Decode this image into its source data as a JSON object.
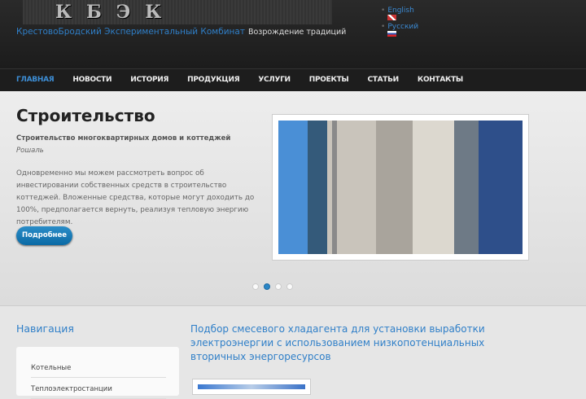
{
  "header": {
    "logo_text": "КБЭК",
    "site_name": "КрестовоБродский Экспериментальный Комбинат",
    "slogan": "Возрождение традиций"
  },
  "languages": [
    {
      "label": "English",
      "flag": "uk"
    },
    {
      "label": "Русский",
      "flag": "ru"
    }
  ],
  "nav": [
    "ГЛАВНАЯ",
    "НОВОСТИ",
    "ИСТОРИЯ",
    "ПРОДУКЦИЯ",
    "УСЛУГИ",
    "ПРОЕКТЫ",
    "СТАТЬИ",
    "КОНТАКТЫ"
  ],
  "slider": {
    "title": "Строительство",
    "subtitle": "Строительство многоквартирных домов и коттеджей",
    "author": "Рошаль",
    "text": "Одновременно мы можем рассмотреть вопрос об инвестировании собственных средств в строительство коттеджей. Вложенные средства, которые могут доходить до 100%, предполагается вернуть, реализуя тепловую энергию потребителям.",
    "button": "Подробнее",
    "active_slide": 2,
    "slide_count": 4
  },
  "sidebar": {
    "title": "Навигация",
    "items": [
      "Котельные",
      "Теплоэлектростанции"
    ]
  },
  "article": {
    "title": "Подбор смесевого хладагента для установки выработки электроэнергии с использованием низкопотенциальных вторичных энергоресурсов"
  }
}
